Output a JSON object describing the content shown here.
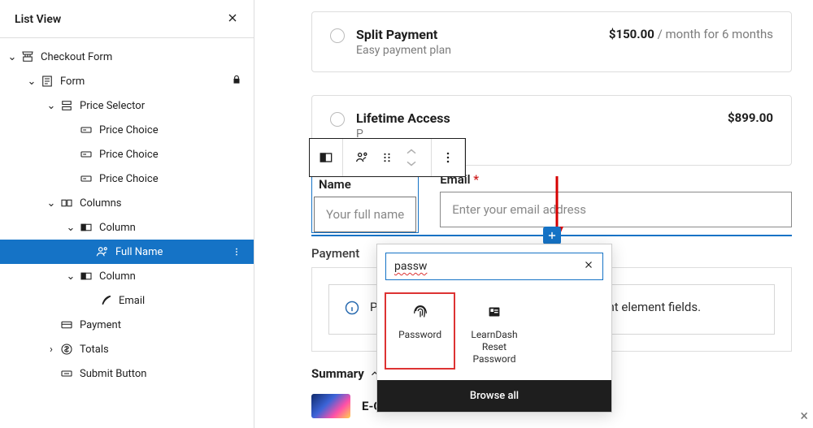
{
  "sidebar": {
    "title": "List View",
    "tree": {
      "checkoutForm": "Checkout Form",
      "form": "Form",
      "priceSelector": "Price Selector",
      "priceChoice": "Price Choice",
      "columns": "Columns",
      "column": "Column",
      "fullName": "Full Name",
      "email": "Email",
      "payment": "Payment",
      "totals": "Totals",
      "submitButton": "Submit Button"
    }
  },
  "main": {
    "splitPayment": {
      "title": "Split Payment",
      "subtitle": "Easy payment plan",
      "price": "$150.00",
      "term": " / month for 6 months"
    },
    "lifetime": {
      "title": "Lifetime Access",
      "subtitle": "P",
      "price": "$899.00"
    },
    "fields": {
      "nameLabel": "Name",
      "namePlaceholder": "Your full name",
      "emailLabel": "Email",
      "emailPlaceholder": "Enter your email address"
    },
    "paymentLabel": "Payment",
    "notice": "Please preview your form to view the payment element fields.",
    "summaryLabel": "Summary",
    "courseTitle": "E-Commerce Course"
  },
  "inserter": {
    "search": "passw",
    "password": "Password",
    "learndash": "LearnDash Reset Password",
    "browse": "Browse all"
  }
}
